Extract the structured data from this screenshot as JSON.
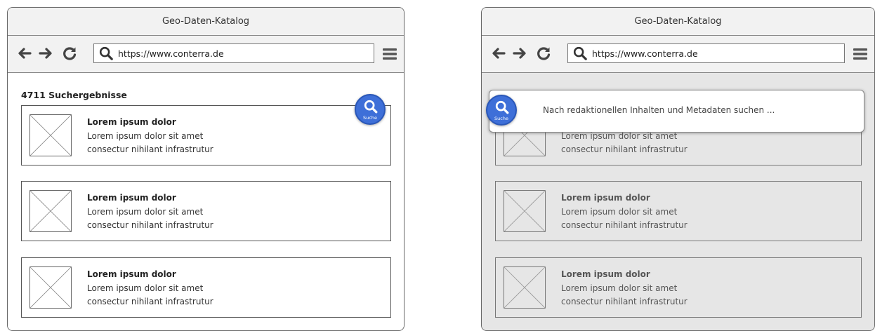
{
  "left": {
    "window_title": "Geo-Daten-Katalog",
    "url": "https://www.conterra.de",
    "results_count": "4711 Suchergebnisse",
    "search_button_label": "Suche",
    "cards": [
      {
        "title": "Lorem ipsum dolor",
        "line1": "Lorem ipsum dolor sit amet",
        "line2": "consectur nihilant infrastrutur"
      },
      {
        "title": "Lorem ipsum dolor",
        "line1": "Lorem ipsum dolor sit amet",
        "line2": "consectur nihilant infrastrutur"
      },
      {
        "title": "Lorem ipsum dolor",
        "line1": "Lorem ipsum dolor sit amet",
        "line2": "consectur nihilant infrastrutur"
      }
    ]
  },
  "right": {
    "window_title": "Geo-Daten-Katalog",
    "url": "https://www.conterra.de",
    "search_button_label": "Suche",
    "search_placeholder": "Nach redaktionellen Inhalten und Metadaten suchen ...",
    "cards": [
      {
        "line1": "Lorem ipsum dolor sit amet",
        "line2": "consectur nihilant infrastrutur"
      },
      {
        "title": "Lorem ipsum dolor",
        "line1": "Lorem ipsum dolor sit amet",
        "line2": "consectur nihilant infrastrutur"
      },
      {
        "title": "Lorem ipsum dolor",
        "line1": "Lorem ipsum dolor sit amet",
        "line2": "consectur nihilant infrastrutur"
      }
    ]
  }
}
